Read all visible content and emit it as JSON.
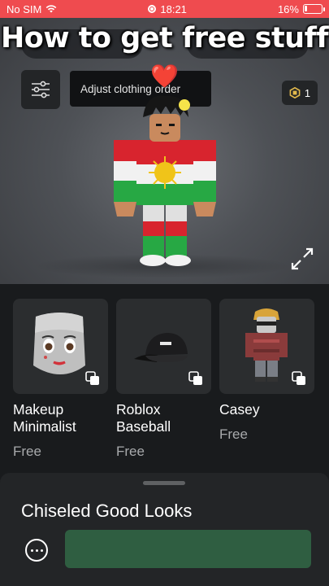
{
  "status_bar": {
    "carrier": "No SIM",
    "time": "18:21",
    "battery": "16%",
    "battery_level": 0.16,
    "background_color": "#ef4b4f",
    "icons": [
      "wifi-icon",
      "screen-record-icon",
      "battery-charging-icon"
    ]
  },
  "video_overlay": {
    "title": "How to get free stuff",
    "emoji": "❤️"
  },
  "avatar_editor": {
    "filter_button_icon": "sliders-icon",
    "tooltip_text": "Adjust clothing order",
    "robux_balance": "1",
    "robux_icon": "robux-icon",
    "expand_icon": "expand-arrows-icon"
  },
  "items": [
    {
      "name": "Makeup Minimalist",
      "price": "Free",
      "icon": "makeup-face-thumbnail"
    },
    {
      "name": "Roblox Baseball",
      "price": "Free",
      "icon": "baseball-cap-thumbnail"
    },
    {
      "name": "Casey",
      "price": "Free",
      "icon": "casey-avatar-thumbnail"
    }
  ],
  "bottom_sheet": {
    "title": "Chiseled Good Looks",
    "more_icon": "more-options-icon",
    "action_button_color": "#2f5e41"
  }
}
